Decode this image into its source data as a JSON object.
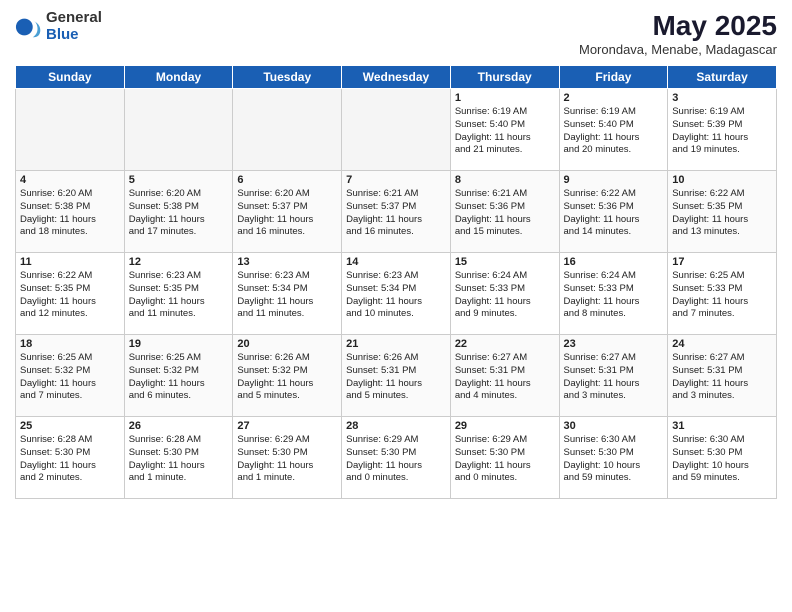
{
  "logo": {
    "general": "General",
    "blue": "Blue"
  },
  "title": "May 2025",
  "subtitle": "Morondava, Menabe, Madagascar",
  "days": [
    "Sunday",
    "Monday",
    "Tuesday",
    "Wednesday",
    "Thursday",
    "Friday",
    "Saturday"
  ],
  "weeks": [
    [
      {
        "day": "",
        "info": ""
      },
      {
        "day": "",
        "info": ""
      },
      {
        "day": "",
        "info": ""
      },
      {
        "day": "",
        "info": ""
      },
      {
        "day": "1",
        "info": "Sunrise: 6:19 AM\nSunset: 5:40 PM\nDaylight: 11 hours\nand 21 minutes."
      },
      {
        "day": "2",
        "info": "Sunrise: 6:19 AM\nSunset: 5:40 PM\nDaylight: 11 hours\nand 20 minutes."
      },
      {
        "day": "3",
        "info": "Sunrise: 6:19 AM\nSunset: 5:39 PM\nDaylight: 11 hours\nand 19 minutes."
      }
    ],
    [
      {
        "day": "4",
        "info": "Sunrise: 6:20 AM\nSunset: 5:38 PM\nDaylight: 11 hours\nand 18 minutes."
      },
      {
        "day": "5",
        "info": "Sunrise: 6:20 AM\nSunset: 5:38 PM\nDaylight: 11 hours\nand 17 minutes."
      },
      {
        "day": "6",
        "info": "Sunrise: 6:20 AM\nSunset: 5:37 PM\nDaylight: 11 hours\nand 16 minutes."
      },
      {
        "day": "7",
        "info": "Sunrise: 6:21 AM\nSunset: 5:37 PM\nDaylight: 11 hours\nand 16 minutes."
      },
      {
        "day": "8",
        "info": "Sunrise: 6:21 AM\nSunset: 5:36 PM\nDaylight: 11 hours\nand 15 minutes."
      },
      {
        "day": "9",
        "info": "Sunrise: 6:22 AM\nSunset: 5:36 PM\nDaylight: 11 hours\nand 14 minutes."
      },
      {
        "day": "10",
        "info": "Sunrise: 6:22 AM\nSunset: 5:35 PM\nDaylight: 11 hours\nand 13 minutes."
      }
    ],
    [
      {
        "day": "11",
        "info": "Sunrise: 6:22 AM\nSunset: 5:35 PM\nDaylight: 11 hours\nand 12 minutes."
      },
      {
        "day": "12",
        "info": "Sunrise: 6:23 AM\nSunset: 5:35 PM\nDaylight: 11 hours\nand 11 minutes."
      },
      {
        "day": "13",
        "info": "Sunrise: 6:23 AM\nSunset: 5:34 PM\nDaylight: 11 hours\nand 11 minutes."
      },
      {
        "day": "14",
        "info": "Sunrise: 6:23 AM\nSunset: 5:34 PM\nDaylight: 11 hours\nand 10 minutes."
      },
      {
        "day": "15",
        "info": "Sunrise: 6:24 AM\nSunset: 5:33 PM\nDaylight: 11 hours\nand 9 minutes."
      },
      {
        "day": "16",
        "info": "Sunrise: 6:24 AM\nSunset: 5:33 PM\nDaylight: 11 hours\nand 8 minutes."
      },
      {
        "day": "17",
        "info": "Sunrise: 6:25 AM\nSunset: 5:33 PM\nDaylight: 11 hours\nand 7 minutes."
      }
    ],
    [
      {
        "day": "18",
        "info": "Sunrise: 6:25 AM\nSunset: 5:32 PM\nDaylight: 11 hours\nand 7 minutes."
      },
      {
        "day": "19",
        "info": "Sunrise: 6:25 AM\nSunset: 5:32 PM\nDaylight: 11 hours\nand 6 minutes."
      },
      {
        "day": "20",
        "info": "Sunrise: 6:26 AM\nSunset: 5:32 PM\nDaylight: 11 hours\nand 5 minutes."
      },
      {
        "day": "21",
        "info": "Sunrise: 6:26 AM\nSunset: 5:31 PM\nDaylight: 11 hours\nand 5 minutes."
      },
      {
        "day": "22",
        "info": "Sunrise: 6:27 AM\nSunset: 5:31 PM\nDaylight: 11 hours\nand 4 minutes."
      },
      {
        "day": "23",
        "info": "Sunrise: 6:27 AM\nSunset: 5:31 PM\nDaylight: 11 hours\nand 3 minutes."
      },
      {
        "day": "24",
        "info": "Sunrise: 6:27 AM\nSunset: 5:31 PM\nDaylight: 11 hours\nand 3 minutes."
      }
    ],
    [
      {
        "day": "25",
        "info": "Sunrise: 6:28 AM\nSunset: 5:30 PM\nDaylight: 11 hours\nand 2 minutes."
      },
      {
        "day": "26",
        "info": "Sunrise: 6:28 AM\nSunset: 5:30 PM\nDaylight: 11 hours\nand 1 minute."
      },
      {
        "day": "27",
        "info": "Sunrise: 6:29 AM\nSunset: 5:30 PM\nDaylight: 11 hours\nand 1 minute."
      },
      {
        "day": "28",
        "info": "Sunrise: 6:29 AM\nSunset: 5:30 PM\nDaylight: 11 hours\nand 0 minutes."
      },
      {
        "day": "29",
        "info": "Sunrise: 6:29 AM\nSunset: 5:30 PM\nDaylight: 11 hours\nand 0 minutes."
      },
      {
        "day": "30",
        "info": "Sunrise: 6:30 AM\nSunset: 5:30 PM\nDaylight: 10 hours\nand 59 minutes."
      },
      {
        "day": "31",
        "info": "Sunrise: 6:30 AM\nSunset: 5:30 PM\nDaylight: 10 hours\nand 59 minutes."
      }
    ]
  ]
}
